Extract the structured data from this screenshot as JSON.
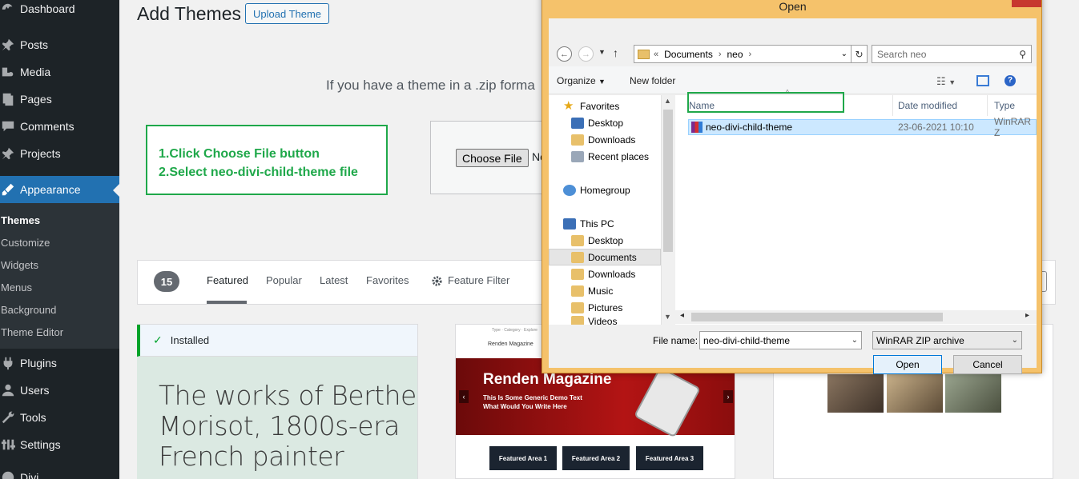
{
  "sidebar": {
    "items": [
      {
        "label": "Dashboard",
        "icon": "dashboard-icon"
      },
      {
        "label": "Posts",
        "icon": "pin-icon"
      },
      {
        "label": "Media",
        "icon": "media-icon"
      },
      {
        "label": "Pages",
        "icon": "pages-icon"
      },
      {
        "label": "Comments",
        "icon": "comment-icon"
      },
      {
        "label": "Projects",
        "icon": "pin-icon"
      },
      {
        "label": "Appearance",
        "icon": "brush-icon"
      },
      {
        "label": "Plugins",
        "icon": "plug-icon"
      },
      {
        "label": "Users",
        "icon": "users-icon"
      },
      {
        "label": "Tools",
        "icon": "wrench-icon"
      },
      {
        "label": "Settings",
        "icon": "settings-icon"
      },
      {
        "label": "Divi",
        "icon": "divi-icon"
      }
    ],
    "submenu": [
      "Themes",
      "Customize",
      "Widgets",
      "Menus",
      "Background",
      "Theme Editor"
    ]
  },
  "header": {
    "title": "Add Themes",
    "upload_label": "Upload Theme"
  },
  "upload": {
    "help_text": "If you have a theme in a .zip forma",
    "choose_label": "Choose File",
    "no_file_text": "No"
  },
  "annotation": {
    "line1": "1.Click Choose File button",
    "line2": "2.Select neo-divi-child-theme file"
  },
  "filter": {
    "count": "15",
    "tabs": [
      "Featured",
      "Popular",
      "Latest",
      "Favorites"
    ],
    "feature_filter": "Feature Filter"
  },
  "themes": {
    "installed_label": "Installed",
    "card1_lines": [
      "The works of Berthe",
      "Morisot, 1800s-era",
      "French painter"
    ],
    "card2": {
      "logo": "Renden Magazine",
      "hero_title": "Renden Magazine",
      "hero_sub1": "This Is Some Generic Demo Text",
      "hero_sub2": "What Would You Write Here",
      "features": [
        "Featured Area 1",
        "Featured Area 2",
        "Featured Area 3"
      ]
    }
  },
  "dialog": {
    "title": "Open",
    "path": [
      "Documents",
      "neo"
    ],
    "search_placeholder": "Search neo",
    "organize": "Organize",
    "new_folder": "New folder",
    "nav": {
      "favorites": "Favorites",
      "fav_items": [
        "Desktop",
        "Downloads",
        "Recent places"
      ],
      "homegroup": "Homegroup",
      "this_pc": "This PC",
      "pc_items": [
        "Desktop",
        "Documents",
        "Downloads",
        "Music",
        "Pictures",
        "Videos"
      ]
    },
    "columns": {
      "name": "Name",
      "date": "Date modified",
      "type": "Type"
    },
    "file": {
      "name": "neo-divi-child-theme",
      "date": "23-06-2021 10:10",
      "type": "WinRAR Z"
    },
    "filename_label": "File name:",
    "filename_value": "neo-divi-child-theme",
    "filetype_value": "WinRAR ZIP archive",
    "open_label": "Open",
    "cancel_label": "Cancel"
  },
  "colors": {
    "sidebar_bg": "#1d2327",
    "accent": "#2271b1",
    "annotation": "#1fa84a",
    "dialog_frame": "#f5c26b"
  }
}
